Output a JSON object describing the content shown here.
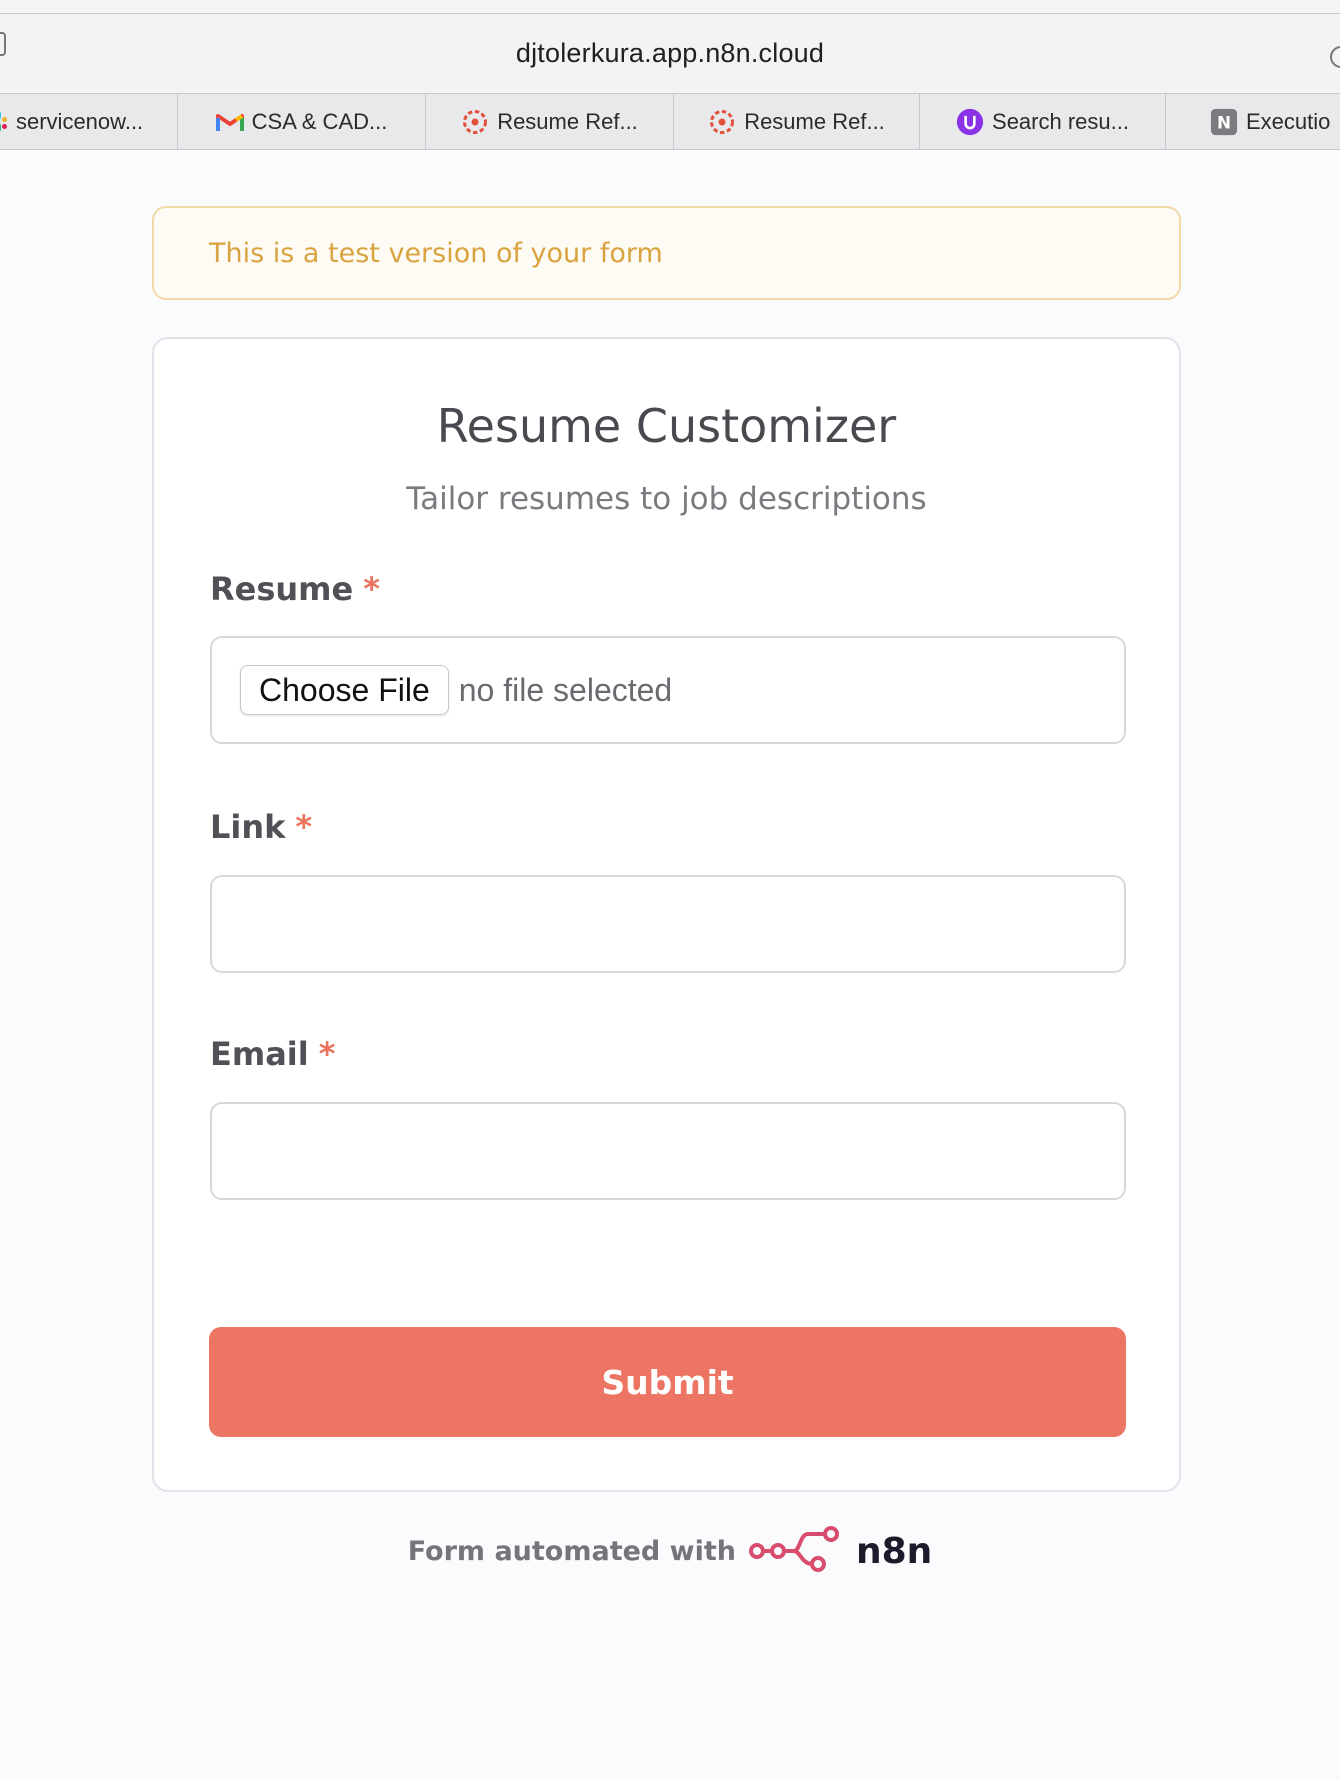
{
  "browser": {
    "url": "djtolerkura.app.n8n.cloud",
    "tabs": [
      {
        "label": "servicenow...",
        "icon": "slack-icon"
      },
      {
        "label": "CSA & CAD...",
        "icon": "gmail-icon"
      },
      {
        "label": "Resume Ref...",
        "icon": "asterisk-logo-icon"
      },
      {
        "label": "Resume Ref...",
        "icon": "asterisk-logo-icon"
      },
      {
        "label": "Search resu...",
        "icon": "u-logo-icon"
      },
      {
        "label": "Executio",
        "icon": "n-logo-icon"
      }
    ]
  },
  "notice": {
    "text": "This is a test version of your form"
  },
  "form": {
    "title": "Resume Customizer",
    "subtitle": "Tailor resumes to job descriptions",
    "required_marker": "*",
    "fields": {
      "resume": {
        "label": "Resume",
        "button_label": "Choose File",
        "status": "no file selected"
      },
      "link": {
        "label": "Link",
        "value": ""
      },
      "email": {
        "label": "Email",
        "value": ""
      }
    },
    "submit_label": "Submit"
  },
  "footer": {
    "text": "Form automated with",
    "brand": "n8n"
  },
  "colors": {
    "accent": "#ec7563",
    "notice_text": "#d9a33f",
    "notice_border": "#f2d9a6",
    "required": "#e9735d",
    "brand_logo": "#d84c6e"
  }
}
